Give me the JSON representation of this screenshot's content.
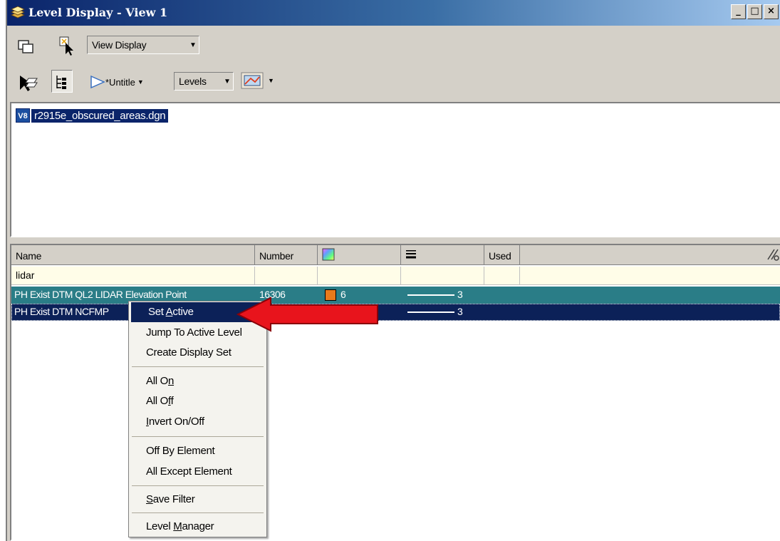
{
  "window": {
    "title": "Level Display - View 1",
    "controls": [
      "_",
      "□",
      "×"
    ]
  },
  "toolbar1": {
    "view_combo": "View Display"
  },
  "toolbar2": {
    "filter_combo": "*Untitle",
    "levels_combo": "Levels"
  },
  "files": [
    {
      "badge": "V8",
      "name": "r2915e_obscured_areas.dgn"
    }
  ],
  "table": {
    "headers": {
      "name": "Name",
      "number": "Number",
      "used": "Used"
    },
    "filter": {
      "name": "lidar"
    },
    "rows": [
      {
        "name": "PH Exist DTM QL2 LIDAR Elevation Point",
        "number": "16306",
        "color_value": "6",
        "color_hex": "#e87a1c",
        "weight": "3"
      },
      {
        "name": "PH Exist DTM NCFMP",
        "number": "",
        "color_value": "",
        "weight": "3"
      }
    ]
  },
  "context_menu": {
    "set_active": {
      "pre": "Set ",
      "key": "A",
      "post": "ctive"
    },
    "jump_active": "Jump To Active Level",
    "create_display_set": "Create Display Set",
    "all_on": {
      "pre": "All O",
      "key": "n",
      "post": ""
    },
    "all_off": {
      "pre": "All O",
      "key": "f",
      "post": "f"
    },
    "invert": {
      "pre": "",
      "key": "I",
      "post": "nvert On/Off"
    },
    "off_by_element": "Off By Element",
    "all_except_element": "All Except Element",
    "save_filter": {
      "pre": "",
      "key": "S",
      "post": "ave Filter"
    },
    "level_manager": {
      "pre": "Level ",
      "key": "M",
      "post": "anager"
    }
  },
  "colors": {
    "selection": "#0c2158",
    "row_highlight": "#2a7d87",
    "annotation_arrow": "#e8141c"
  }
}
